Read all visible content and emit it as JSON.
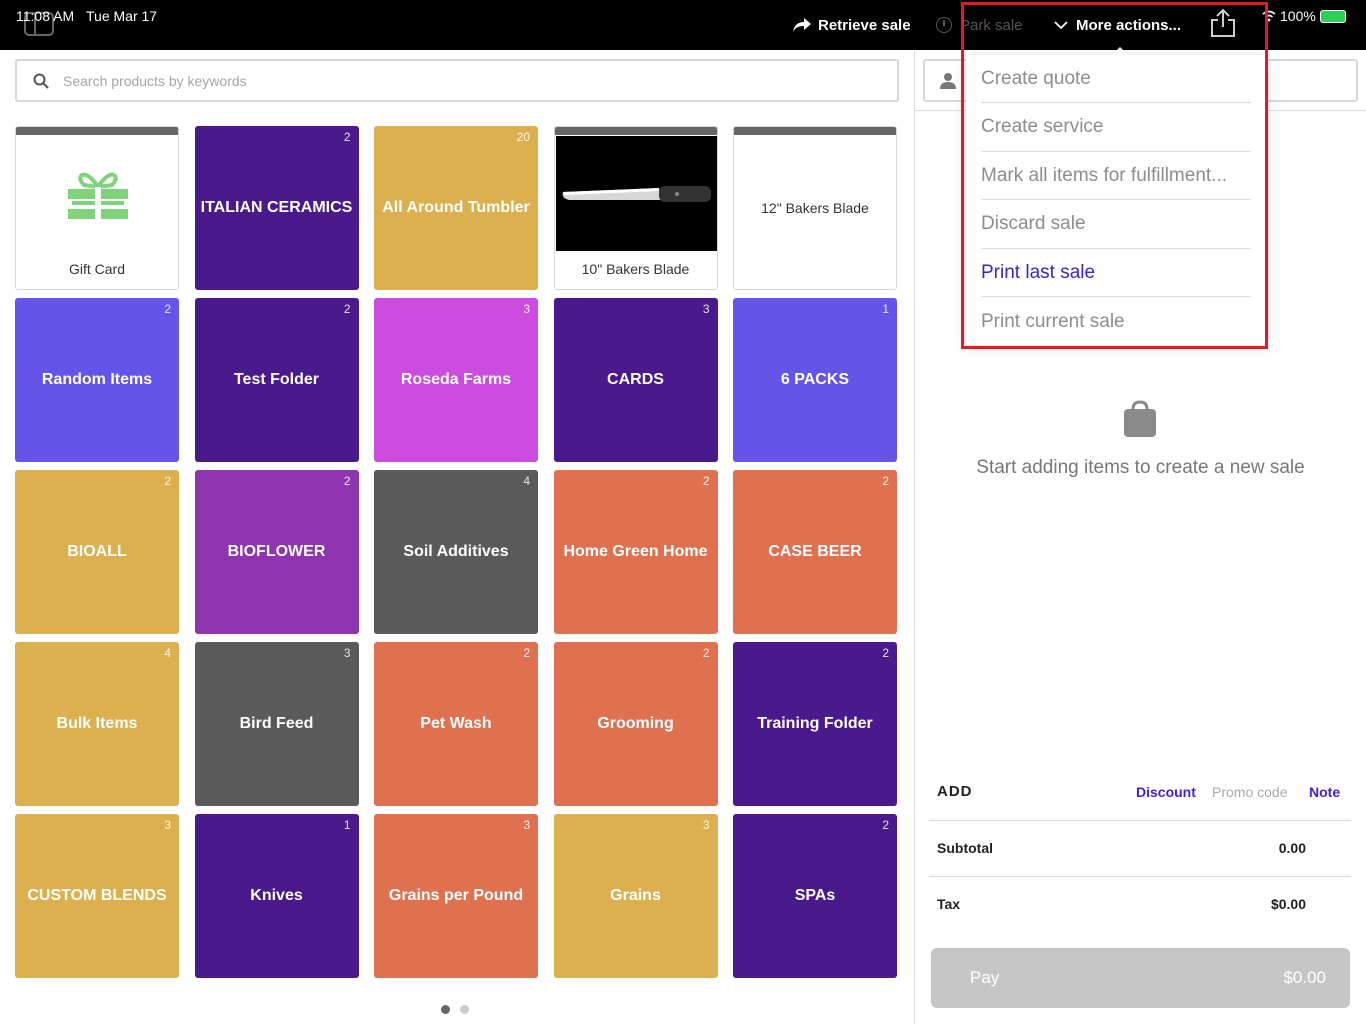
{
  "status_bar": {
    "time": "11:08 AM",
    "date": "Tue Mar 17",
    "battery": "100%"
  },
  "toolbar": {
    "retrieve_label": "Retrieve sale",
    "park_label": "Park sale",
    "more_label": "More actions..."
  },
  "search": {
    "placeholder": "Search products by keywords"
  },
  "tiles": [
    {
      "label": "Gift Card",
      "count": "",
      "color": "#ffffff",
      "kind": "gift"
    },
    {
      "label": "ITALIAN CERAMICS",
      "count": "2",
      "color": "#4a1a8c"
    },
    {
      "label": "All Around Tumbler",
      "count": "20",
      "color": "#ddb04f"
    },
    {
      "label": "10\" Bakers Blade",
      "count": "",
      "color": "#ffffff",
      "kind": "knife"
    },
    {
      "label": "12\" Bakers Blade",
      "count": "",
      "color": "#ffffff",
      "kind": "plain"
    },
    {
      "label": "Random Items",
      "count": "2",
      "color": "#6554ea"
    },
    {
      "label": "Test Folder",
      "count": "2",
      "color": "#4a1a8c"
    },
    {
      "label": "Roseda Farms",
      "count": "3",
      "color": "#cc4ce0"
    },
    {
      "label": "CARDS",
      "count": "3",
      "color": "#4a1a8c"
    },
    {
      "label": "6 PACKS",
      "count": "1",
      "color": "#6554ea"
    },
    {
      "label": "BIOALL",
      "count": "2",
      "color": "#ddb04f"
    },
    {
      "label": "BIOFLOWER",
      "count": "2",
      "color": "#9035b0"
    },
    {
      "label": "Soil Additives",
      "count": "4",
      "color": "#5a5a5a"
    },
    {
      "label": "Home Green Home",
      "count": "2",
      "color": "#e07150"
    },
    {
      "label": "CASE BEER",
      "count": "2",
      "color": "#e07150"
    },
    {
      "label": "Bulk Items",
      "count": "4",
      "color": "#ddb04f"
    },
    {
      "label": "Bird Feed",
      "count": "3",
      "color": "#5a5a5a"
    },
    {
      "label": "Pet Wash",
      "count": "2",
      "color": "#e07150"
    },
    {
      "label": "Grooming",
      "count": "2",
      "color": "#e07150"
    },
    {
      "label": "Training Folder",
      "count": "2",
      "color": "#4a1a8c"
    },
    {
      "label": "CUSTOM BLENDS",
      "count": "3",
      "color": "#ddb04f"
    },
    {
      "label": "Knives",
      "count": "1",
      "color": "#4a1a8c"
    },
    {
      "label": "Grains per Pound",
      "count": "3",
      "color": "#e07150"
    },
    {
      "label": "Grains",
      "count": "3",
      "color": "#ddb04f"
    },
    {
      "label": "SPAs",
      "count": "2",
      "color": "#4a1a8c"
    }
  ],
  "sale": {
    "empty_text": "Start adding items to create a new sale",
    "add_label": "ADD",
    "discount_label": "Discount",
    "promo_label": "Promo code",
    "note_label": "Note",
    "subtotal_label": "Subtotal",
    "subtotal_value": "0.00",
    "tax_label": "Tax",
    "tax_value": "$0.00",
    "pay_label": "Pay",
    "pay_amount": "$0.00"
  },
  "more_actions_menu": [
    {
      "label": "Create quote",
      "active": false
    },
    {
      "label": "Create service",
      "active": false
    },
    {
      "label": "Mark all items for fulfillment...",
      "active": false
    },
    {
      "label": "Discard sale",
      "active": false
    },
    {
      "label": "Print last sale",
      "active": true
    },
    {
      "label": "Print current sale",
      "active": false
    }
  ],
  "colors": {
    "accent": "#3a22d8",
    "highlight": "#e01b24"
  },
  "pagination": {
    "pages": 2,
    "current": 1
  }
}
